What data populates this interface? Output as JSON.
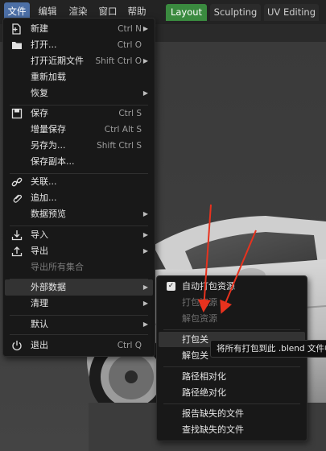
{
  "menubar": {
    "items": [
      {
        "label": "文件"
      },
      {
        "label": "编辑"
      },
      {
        "label": "渲染"
      },
      {
        "label": "窗口"
      },
      {
        "label": "帮助"
      }
    ]
  },
  "workspace_tabs": [
    {
      "label": "Layout"
    },
    {
      "label": "Sculpting"
    },
    {
      "label": "UV Editing"
    }
  ],
  "file_menu": {
    "new": {
      "label": "新建",
      "shortcut": "Ctrl N"
    },
    "open": {
      "label": "打开...",
      "shortcut": "Ctrl O"
    },
    "open_recent": {
      "label": "打开近期文件",
      "shortcut": "Shift Ctrl O"
    },
    "revert": {
      "label": "重新加载"
    },
    "recover": {
      "label": "恢复"
    },
    "save": {
      "label": "保存",
      "shortcut": "Ctrl S"
    },
    "save_incremental": {
      "label": "增量保存",
      "shortcut": "Ctrl Alt S"
    },
    "save_as": {
      "label": "另存为...",
      "shortcut": "Shift Ctrl S"
    },
    "save_copy": {
      "label": "保存副本..."
    },
    "link": {
      "label": "关联..."
    },
    "append": {
      "label": "追加..."
    },
    "data_previews": {
      "label": "数据预览"
    },
    "import": {
      "label": "导入"
    },
    "export": {
      "label": "导出"
    },
    "export_all_collections": {
      "label": "导出所有集合"
    },
    "external_data": {
      "label": "外部数据"
    },
    "clean_up": {
      "label": "清理"
    },
    "defaults": {
      "label": "默认"
    },
    "quit": {
      "label": "退出",
      "shortcut": "Ctrl Q"
    }
  },
  "external_data_menu": {
    "autopack": {
      "label": "自动打包资源",
      "checked": true
    },
    "pack_resources": {
      "label": "打包资源"
    },
    "unpack_resources": {
      "label": "解包资源"
    },
    "pack_linked": {
      "label": "打包关"
    },
    "unpack_linked": {
      "label": "解包关"
    },
    "make_relative": {
      "label": "路径相对化"
    },
    "make_absolute": {
      "label": "路径绝对化"
    },
    "report_missing": {
      "label": "报告缺失的文件"
    },
    "find_missing": {
      "label": "查找缺失的文件"
    }
  },
  "tooltip": {
    "text": "将所有打包到此 .blend 文件中"
  },
  "colors": {
    "active_tab": "#3a8a3f",
    "menu_highlight": "#4c6fa6",
    "annotation_arrow": "#e8321e"
  },
  "icons": {
    "new": "new-file-icon",
    "open": "folder-icon",
    "save": "floppy-disk-icon",
    "link": "link-icon",
    "append": "paperclip-icon",
    "import": "import-icon",
    "export": "export-icon",
    "quit": "power-icon",
    "autopack": "checkbox-checked-icon"
  }
}
